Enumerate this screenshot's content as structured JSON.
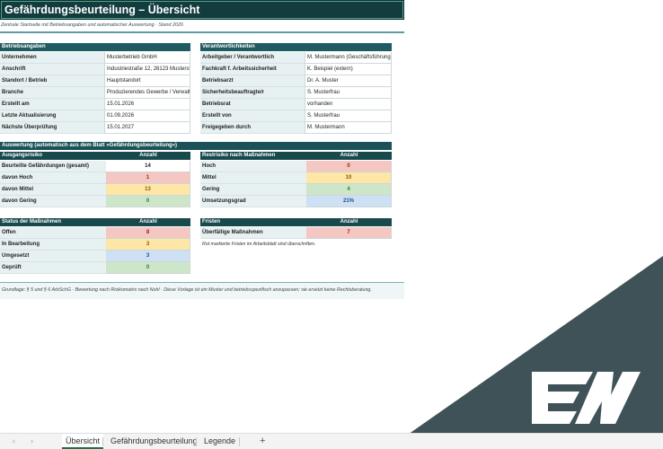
{
  "title": "Gefährdungsbeurteilung – Übersicht",
  "subtitle": "Zentrale Startseite mit Betriebsangaben und automatischer Auswertung · Stand 2026",
  "betrieb": {
    "header": "Betriebsangaben",
    "rows": [
      {
        "label": "Unternehmen",
        "value": "Musterbetrieb GmbH"
      },
      {
        "label": "Anschrift",
        "value": "Industriestraße 12, 26123 Musterstadt"
      },
      {
        "label": "Standort / Betrieb",
        "value": "Hauptstandort"
      },
      {
        "label": "Branche",
        "value": "Produzierendes Gewerbe / Verwaltung"
      },
      {
        "label": "Erstellt am",
        "value": "15.01.2026"
      },
      {
        "label": "Letzte Aktualisierung",
        "value": "01.09.2026"
      },
      {
        "label": "Nächste Überprüfung",
        "value": "15.01.2027"
      }
    ]
  },
  "verantwortlich": {
    "header": "Verantwortlichkeiten",
    "rows": [
      {
        "label": "Arbeitgeber / Verantwortlich",
        "value": "M. Mustermann (Geschäftsführung)"
      },
      {
        "label": "Fachkraft f. Arbeitssicherheit",
        "value": "K. Beispiel (extern)"
      },
      {
        "label": "Betriebsarzt",
        "value": "Dr. A. Muster"
      },
      {
        "label": "Sicherheitsbeauftragte/r",
        "value": "S. Musterfrau"
      },
      {
        "label": "Betriebsrat",
        "value": "vorhanden"
      },
      {
        "label": "Erstellt von",
        "value": "S. Musterfrau"
      },
      {
        "label": "Freigegeben durch",
        "value": "M. Mustermann"
      }
    ]
  },
  "auswertung_header": "Auswertung (automatisch aus dem Blatt »Gefährdungsbeurteilung«)",
  "ausgangsrisiko": {
    "header": "Ausgangsrisiko",
    "col": "Anzahl",
    "rows": [
      {
        "label": "Beurteilte Gefährdungen (gesamt)",
        "value": "14",
        "color": "plain"
      },
      {
        "label": "davon Hoch",
        "value": "1",
        "color": "red"
      },
      {
        "label": "davon Mittel",
        "value": "13",
        "color": "yellow"
      },
      {
        "label": "davon Gering",
        "value": "0",
        "color": "green"
      }
    ]
  },
  "restrisiko": {
    "header": "Restrisiko nach Maßnahmen",
    "col": "Anzahl",
    "rows": [
      {
        "label": "Hoch",
        "value": "0",
        "color": "red"
      },
      {
        "label": "Mittel",
        "value": "10",
        "color": "yellow"
      },
      {
        "label": "Gering",
        "value": "4",
        "color": "green"
      },
      {
        "label": "Umsetzungsgrad",
        "value": "21%",
        "color": "blue"
      }
    ]
  },
  "status": {
    "header": "Status der Maßnahmen",
    "col": "Anzahl",
    "rows": [
      {
        "label": "Offen",
        "value": "8",
        "color": "red"
      },
      {
        "label": "In Bearbeitung",
        "value": "3",
        "color": "yellow"
      },
      {
        "label": "Umgesetzt",
        "value": "3",
        "color": "blue"
      },
      {
        "label": "Geprüft",
        "value": "0",
        "color": "green"
      }
    ]
  },
  "fristen": {
    "header": "Fristen",
    "col": "Anzahl",
    "rows": [
      {
        "label": "Überfällige Maßnahmen",
        "value": "7",
        "color": "red"
      }
    ],
    "note": "Rot markierte Fristen im Arbeitsblatt sind überschritten."
  },
  "footer": "Grundlage: § 5 und § 6 ArbSchG · Bewertung nach Risikomatrix nach Nohl · Diese Vorlage ist ein Muster und betriebsspezifisch anzupassen; sie ersetzt keine Rechtsberatung.",
  "tabs": {
    "tab1": "Übersicht",
    "tab2": "Gefährdungsbeurteilung",
    "tab3": "Legende",
    "add": "+",
    "prev": "‹",
    "next": "›"
  },
  "colors": {
    "header_dark": "#123c3e",
    "header_section": "#1f5b61",
    "corner_triangle": "#3f5257",
    "red": "#f4c7c3",
    "yellow": "#fde6a6",
    "green": "#cde6c9",
    "blue": "#cde0f4"
  },
  "icons": {
    "logo": "ex-logo"
  }
}
